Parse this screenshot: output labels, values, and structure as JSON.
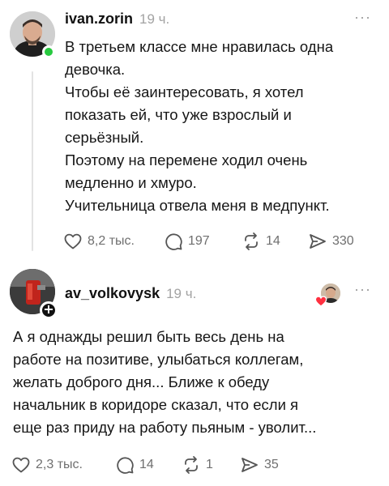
{
  "posts": [
    {
      "username": "ivan.zorin",
      "time": "19 ч.",
      "more": "···",
      "lines": [
        "В третьем классе мне нравилась одна",
        "девочка.",
        "Чтобы её заинтересовать, я хотел",
        "показать ей, что уже взрослый и",
        "серьёзный.",
        "Поэтому на перемене ходил очень",
        "медленно и хмуро.",
        "Учительница отвела меня в медпункт."
      ],
      "likes": "8,2 тыс.",
      "comments": "197",
      "reposts": "14",
      "shares": "330",
      "online_color": "#27c93f"
    },
    {
      "username": "av_volkovysk",
      "time": "19 ч.",
      "more": "···",
      "follow_symbol": "+",
      "lines": [
        "А я однажды решил быть весь день на",
        "работе на позитиве,  улыбаться коллегам,",
        "желать доброго дня... Ближе к обеду",
        "начальник в коридоре сказал, что если я",
        "еще раз приду на работу пьяным - уволит..."
      ],
      "likes": "2,3 тыс.",
      "comments": "14",
      "reposts": "1",
      "shares": "35",
      "reaction_heart_color": "#ff3040"
    }
  ]
}
